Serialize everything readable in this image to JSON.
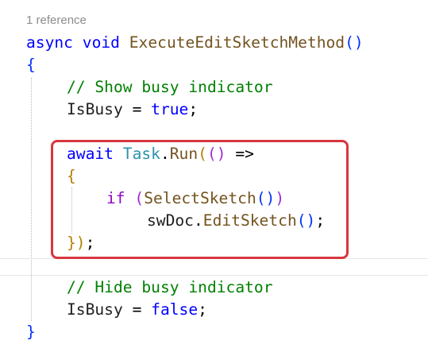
{
  "editor": {
    "codelens": "1 reference",
    "lines": {
      "l1": {
        "kw1": "async",
        "kw2": "void",
        "method": "ExecuteEditSketchMethod",
        "open": "(",
        "close": ")"
      },
      "l2": {
        "brace": "{"
      },
      "l3": {
        "comment": "// Show busy indicator"
      },
      "l4": {
        "ident": "IsBusy",
        "op": " = ",
        "value": "true",
        "semi": ";"
      },
      "l5": {
        "kw": "await",
        "type": "Task",
        "dot": ".",
        "method": "Run",
        "p_open": "(",
        "lambda_open": "(",
        "lambda_close": ")",
        "arrow": " =>"
      },
      "l6": {
        "brace": "{"
      },
      "l7": {
        "kw": "if",
        "p_open": "(",
        "method": "SelectSketch",
        "inner_open": "(",
        "inner_close": ")",
        "p_close": ")"
      },
      "l8": {
        "ident": "swDoc",
        "dot": ".",
        "method": "EditSketch",
        "open": "(",
        "close": ")",
        "semi": ";"
      },
      "l9": {
        "brace": "}",
        "p_close": ")",
        "semi": ";"
      },
      "l10": {
        "comment": "// Hide busy indicator"
      },
      "l11": {
        "ident": "IsBusy",
        "op": " = ",
        "value": "false",
        "semi": ";"
      },
      "l12": {
        "brace": "}"
      }
    }
  },
  "colors": {
    "keyword": "#0000ff",
    "type": "#2b91af",
    "method": "#74531f",
    "comment": "#008000",
    "highlight_border": "#d9363e"
  }
}
